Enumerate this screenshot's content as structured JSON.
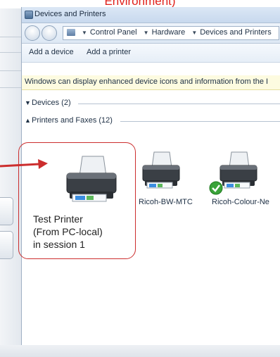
{
  "caption": "Environment)",
  "window": {
    "title": "Devices and Printers",
    "breadcrumb": [
      "Control Panel",
      "Hardware",
      "Devices and Printers"
    ],
    "toolbar": {
      "add_device": "Add a device",
      "add_printer": "Add a printer"
    },
    "info_bar": "Windows can display enhanced device icons and information from the I",
    "groups": {
      "devices": "Devices (2)",
      "printers": "Printers and Faxes (12)"
    },
    "printers": [
      {
        "label": "Ricoh-BW-MTC",
        "is_default": false
      },
      {
        "label": "Ricoh-Colour-Ne",
        "is_default": true
      }
    ]
  },
  "highlight": {
    "line1": "Test Printer",
    "line2": "(From PC-local)",
    "line3": "in session 1"
  },
  "colors": {
    "accent": "#cc2e2e",
    "default_check": "#3aa33a"
  },
  "icons": [
    "back-icon",
    "forward-icon",
    "control-panel-icon",
    "printer-icon",
    "default-check-icon",
    "arrow-icon"
  ]
}
